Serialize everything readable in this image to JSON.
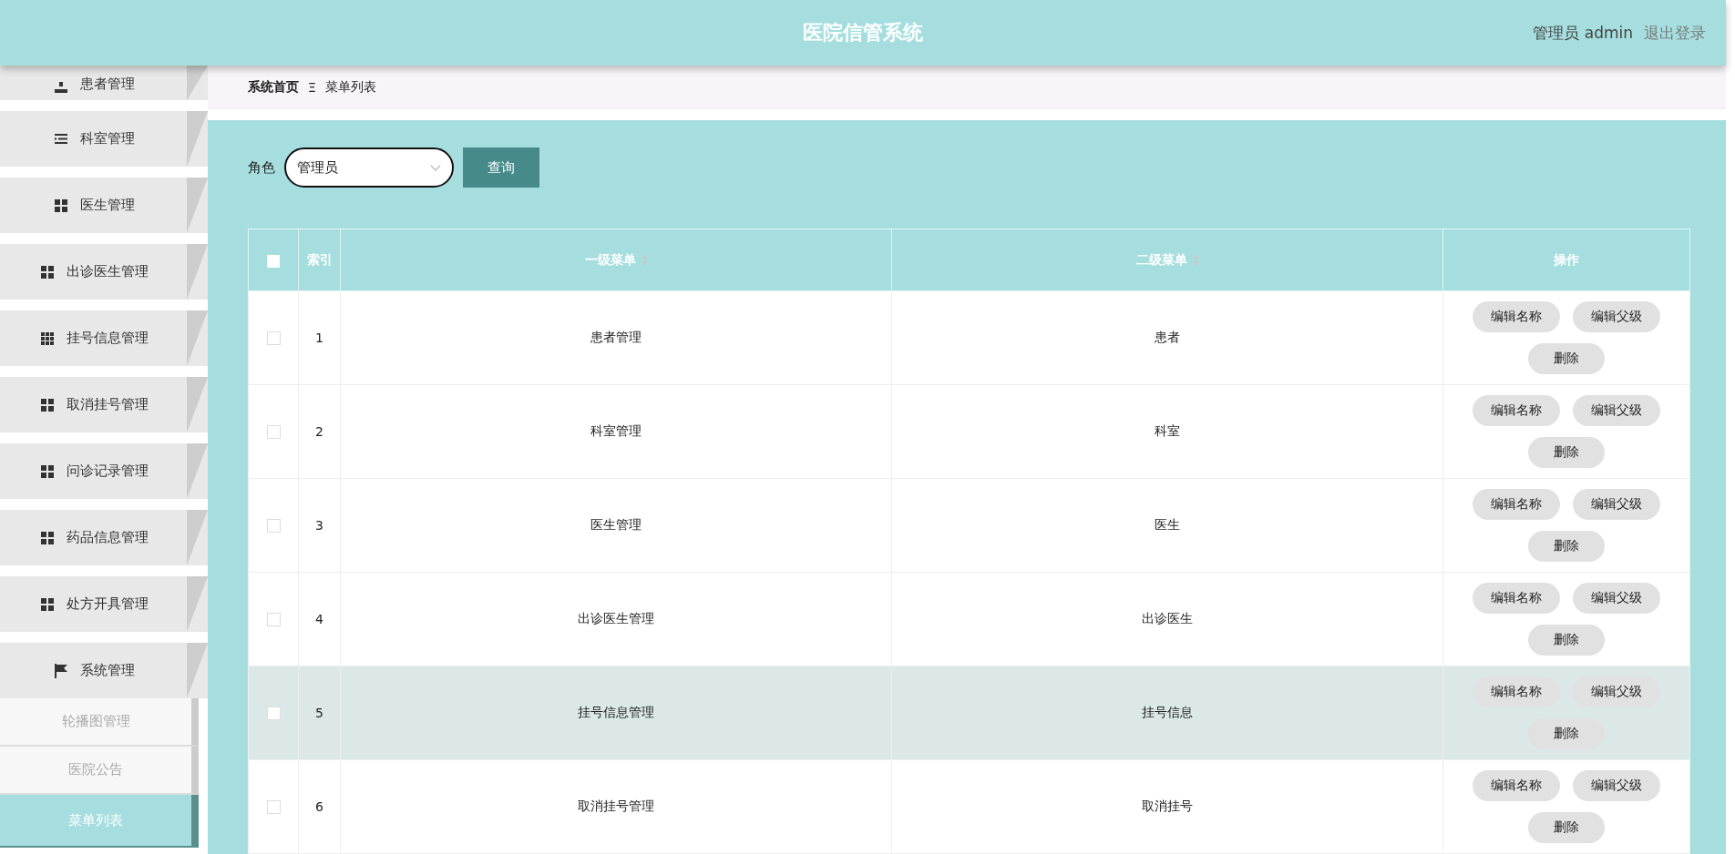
{
  "header": {
    "title": "医院信管系统",
    "user": "管理员 admin",
    "logout": "退出登录"
  },
  "sidebar": {
    "items": [
      {
        "label": "患者管理",
        "kind": "person"
      },
      {
        "label": "科室管理",
        "kind": "list"
      },
      {
        "label": "医生管理",
        "kind": "grid"
      },
      {
        "label": "出诊医生管理",
        "kind": "grid"
      },
      {
        "label": "挂号信息管理",
        "kind": "grid9"
      },
      {
        "label": "取消挂号管理",
        "kind": "grid"
      },
      {
        "label": "问诊记录管理",
        "kind": "grid"
      },
      {
        "label": "药品信息管理",
        "kind": "grid"
      },
      {
        "label": "处方开具管理",
        "kind": "grid"
      },
      {
        "label": "系统管理",
        "kind": "flag",
        "children": [
          {
            "label": "轮播图管理",
            "selected": false
          },
          {
            "label": "医院公告",
            "selected": false
          },
          {
            "label": "菜单列表",
            "selected": true
          }
        ]
      }
    ]
  },
  "breadcrumb": {
    "home": "系统首页",
    "separator": "Ξ",
    "current": "菜单列表"
  },
  "filter": {
    "label": "角色",
    "value": "管理员",
    "button": "查询"
  },
  "table": {
    "header_checked": false,
    "columns": [
      {
        "label": "索引",
        "sortable": false
      },
      {
        "label": "一级菜单",
        "sortable": true
      },
      {
        "label": "二级菜单",
        "sortable": true
      },
      {
        "label": "操作",
        "sortable": false
      }
    ],
    "rows": [
      {
        "index": "1",
        "menu": "患者管理",
        "submenu": "患者",
        "checked": false,
        "highlighted": false,
        "actions": [
          "编辑名称",
          "编辑父级",
          "删除"
        ]
      },
      {
        "index": "2",
        "menu": "科室管理",
        "submenu": "科室",
        "checked": false,
        "highlighted": false,
        "actions": [
          "编辑名称",
          "编辑父级",
          "删除"
        ]
      },
      {
        "index": "3",
        "menu": "医生管理",
        "submenu": "医生",
        "checked": false,
        "highlighted": false,
        "actions": [
          "编辑名称",
          "编辑父级",
          "删除"
        ]
      },
      {
        "index": "4",
        "menu": "出诊医生管理",
        "submenu": "出诊医生",
        "checked": false,
        "highlighted": false,
        "actions": [
          "编辑名称",
          "编辑父级",
          "删除"
        ]
      },
      {
        "index": "5",
        "menu": "挂号信息管理",
        "submenu": "挂号信息",
        "checked": false,
        "highlighted": true,
        "actions": [
          "编辑名称",
          "编辑父级",
          "删除"
        ]
      },
      {
        "index": "6",
        "menu": "取消挂号管理",
        "submenu": "取消挂号",
        "checked": false,
        "highlighted": false,
        "actions": [
          "编辑名称",
          "编辑父级",
          "删除"
        ]
      }
    ]
  }
}
